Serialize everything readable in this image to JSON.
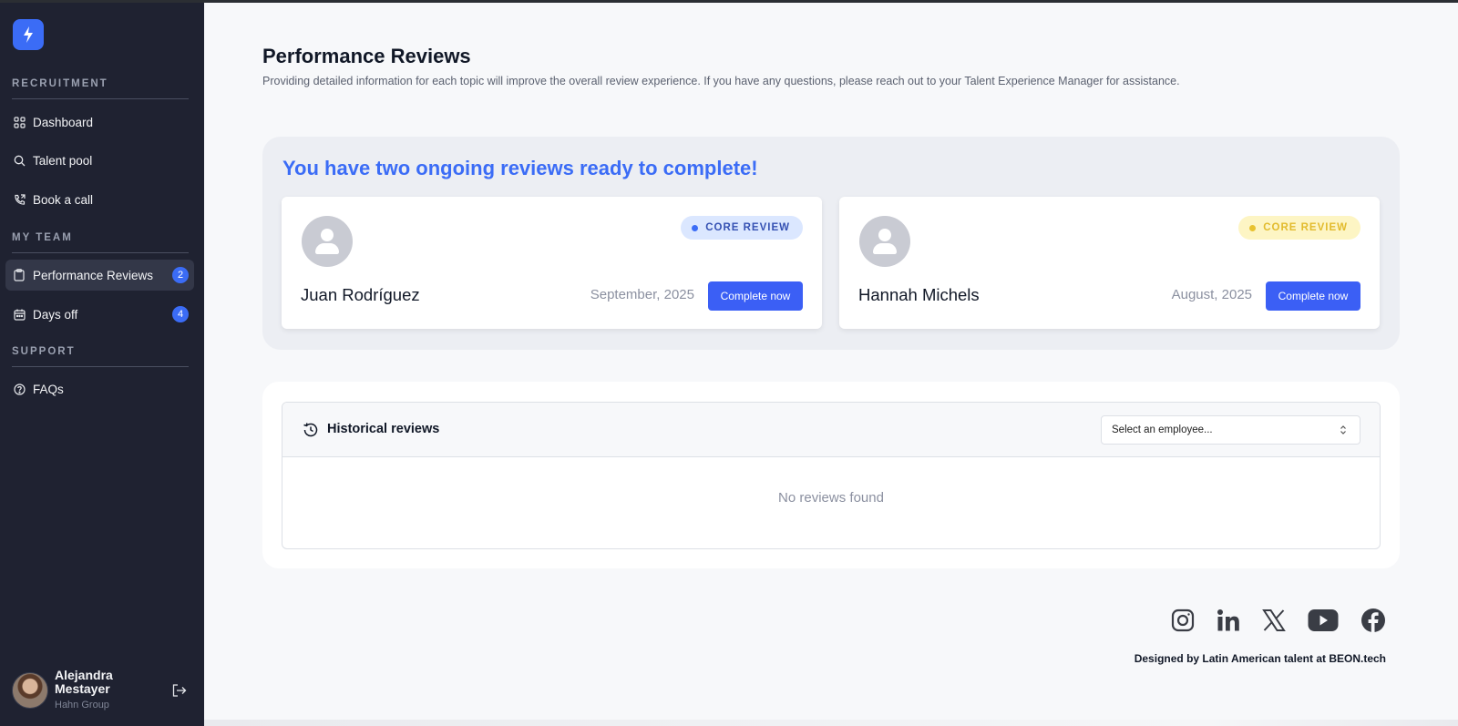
{
  "sidebar": {
    "logo_icon": "lightning-bolt-icon",
    "sections": {
      "recruitment": "RECRUITMENT",
      "my_team": "MY TEAM",
      "support": "SUPPORT"
    },
    "items": {
      "dashboard": {
        "label": "Dashboard",
        "icon": "grid-icon"
      },
      "talent_pool": {
        "label": "Talent pool",
        "icon": "search-icon"
      },
      "book_call": {
        "label": "Book a call",
        "icon": "phone-icon"
      },
      "performance_reviews": {
        "label": "Performance Reviews",
        "icon": "clipboard-icon",
        "badge": "2",
        "active": true
      },
      "days_off": {
        "label": "Days off",
        "icon": "calendar-icon",
        "badge": "4"
      },
      "faqs": {
        "label": "FAQs",
        "icon": "help-circle-icon"
      }
    },
    "user": {
      "name": "Alejandra Mestayer",
      "company": "Hahn Group"
    }
  },
  "header": {
    "title": "Performance Reviews",
    "subtitle": "Providing detailed information for each topic will improve the overall review experience. If you have any questions, please reach out to your Talent Experience Manager for assistance."
  },
  "ongoing": {
    "heading": "You have two ongoing reviews ready to complete!",
    "cards": [
      {
        "name": "Juan Rodríguez",
        "badge": "CORE REVIEW",
        "badge_color": "#3b6cf6",
        "date": "September, 2025",
        "button": "Complete now"
      },
      {
        "name": "Hannah Michels",
        "badge": "CORE REVIEW",
        "badge_color": "#e8c22f",
        "date": "August, 2025",
        "button": "Complete now"
      }
    ]
  },
  "history": {
    "title": "Historical reviews",
    "select_placeholder": "Select an employee...",
    "empty_text": "No reviews found"
  },
  "footer": {
    "social": [
      "instagram-icon",
      "linkedin-icon",
      "x-icon",
      "youtube-icon",
      "facebook-icon"
    ],
    "credit": "Designed by Latin American talent at BEON.tech"
  },
  "colors": {
    "sidebar_bg": "#1f2231",
    "accent": "#3b6cf6",
    "page_bg": "#f7f8fa"
  }
}
